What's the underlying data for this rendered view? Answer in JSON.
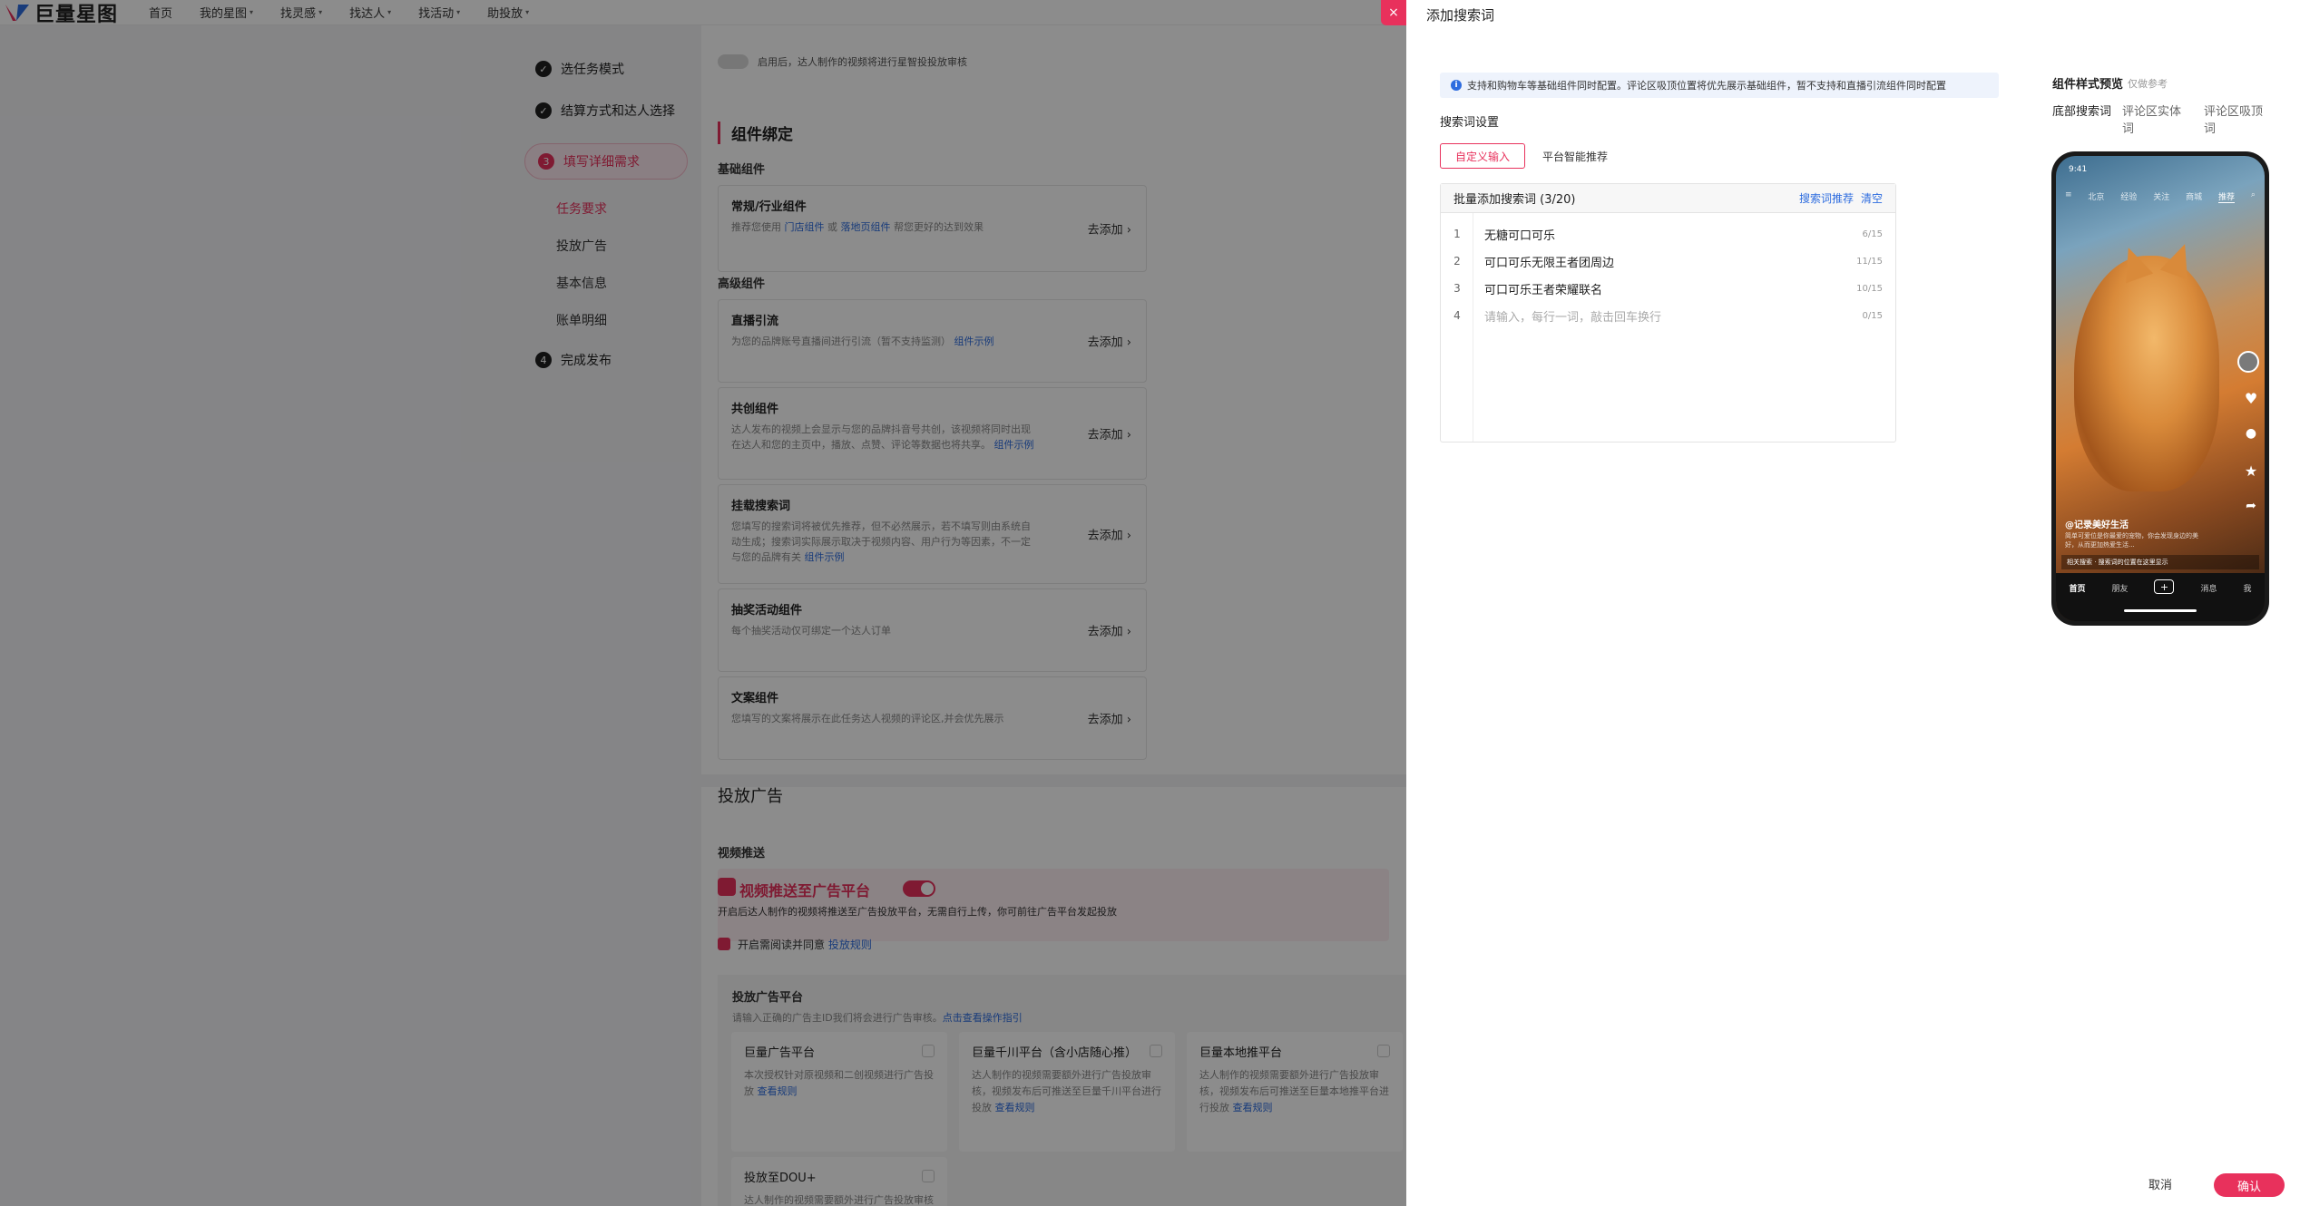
{
  "nav": {
    "logo": "巨量星图",
    "items": [
      {
        "label": "首页",
        "caret": ""
      },
      {
        "label": "我的星图",
        "caret": "▾"
      },
      {
        "label": "找灵感",
        "caret": "▾"
      },
      {
        "label": "找达人",
        "caret": "▾"
      },
      {
        "label": "找活动",
        "caret": "▾"
      },
      {
        "label": "助投放",
        "caret": "▾"
      }
    ]
  },
  "steps": {
    "s1": "选任务模式",
    "s2": "结算方式和达人选择",
    "s3_num": "3",
    "s3": "填写详细需求",
    "sub": [
      "任务要求",
      "投放广告",
      "基本信息",
      "账单明细"
    ],
    "s4_num": "4",
    "s4": "完成发布"
  },
  "main": {
    "top_note": "启用后，达人制作的视频将进行星智投投放审核",
    "comp_bind": "组件绑定",
    "basic_comp": "基础组件",
    "advanced_comp": "高级组件",
    "add_label": "去添加 ›",
    "cards": [
      {
        "title": "常规/行业组件",
        "desc_pre": "推荐您使用 ",
        "link1": "门店组件",
        "mid": " 或 ",
        "link2": "落地页组件",
        "desc_post": " 帮您更好的达到效果"
      },
      {
        "title": "直播引流",
        "desc": "为您的品牌账号直播间进行引流（暂不支持监测）",
        "link": "组件示例"
      },
      {
        "title": "共创组件",
        "desc": "达人发布的视频上会显示与您的品牌抖音号共创，该视频将同时出现在达人和您的主页中，播放、点赞、评论等数据也将共享。",
        "link": "组件示例"
      },
      {
        "title": "挂载搜索词",
        "desc": "您填写的搜索词将被优先推荐，但不必然展示，若不填写则由系统自动生成；搜索词实际展示取决于视频内容、用户行为等因素，不一定与您的品牌有关",
        "link": "组件示例"
      },
      {
        "title": "抽奖活动组件",
        "desc": "每个抽奖活动仅可绑定一个达人订单"
      },
      {
        "title": "文案组件",
        "desc": "您填写的文案将展示在此任务达人视频的评论区,并会优先展示"
      }
    ],
    "ad_title": "投放广告",
    "video_push": "视频推送",
    "push_title": "视频推送至广告平台",
    "push_desc": "开启后达人制作的视频将推送至广告投放平台，无需自行上传，你可前往广告平台发起投放",
    "agree_text": "开启需阅读并同意",
    "agree_link": "投放规则",
    "platform_title": "投放广告平台",
    "platform_desc": "请输入正确的广告主ID我们将会进行广告审核。",
    "platform_link": "点击查看操作指引",
    "platforms": [
      {
        "title": "巨量广告平台",
        "desc": "本次授权针对原视频和二创视频进行广告投放",
        "link": "查看规则"
      },
      {
        "title": "巨量千川平台（含小店随心推）",
        "desc": "达人制作的视频需要额外进行广告投放审核，视频发布后可推送至巨量千川平台进行投放",
        "link": "查看规则"
      },
      {
        "title": "巨量本地推平台",
        "desc": "达人制作的视频需要额外进行广告投放审核，视频发布后可推送至巨量本地推平台进行投放",
        "link": "查看规则"
      },
      {
        "title": "投放至DOU+",
        "desc": "达人制作的视频需要额外进行广告投放审核",
        "link": ""
      }
    ]
  },
  "drawer": {
    "close": "×",
    "title": "添加搜索词",
    "info": "支持和购物车等基础组件同时配置。评论区吸顶位置将优先展示基础组件，暂不支持和直播引流组件同时配置",
    "settings_label": "搜索词设置",
    "tab_custom": "自定义输入",
    "tab_smart": "平台智能推荐",
    "batch_title": "批量添加搜索词 (3/20)",
    "link_recommend": "搜索词推荐",
    "link_clear": "清空",
    "keywords": [
      {
        "num": "1",
        "text": "无糖可口可乐",
        "count": "6/15"
      },
      {
        "num": "2",
        "text": "可口可乐无限王者团周边",
        "count": "11/15"
      },
      {
        "num": "3",
        "text": "可口可乐王者荣耀联名",
        "count": "10/15"
      }
    ],
    "input_row": {
      "num": "4",
      "placeholder": "请输入，每行一词，敲击回车换行",
      "count": "0/15"
    },
    "preview_title": "组件样式预览",
    "preview_note": "仅做参考",
    "preview_tabs": [
      "底部搜索词",
      "评论区实体词",
      "评论区吸顶词"
    ],
    "phone": {
      "time": "9:41",
      "tabs": [
        "≡",
        "北京",
        "经验",
        "关注",
        "商城",
        "推荐",
        "⌕"
      ],
      "caption": "@记录美好生活",
      "desc": "简单可爱位是你最爱的宠物，你会发现身边的美好，从而更加热爱生活...",
      "search": "相关搜索 · 搜索词的位置在这里显示",
      "bottom": [
        "首页",
        "朋友",
        "+",
        "消息",
        "我"
      ]
    },
    "cancel": "取消",
    "confirm": "确认"
  }
}
